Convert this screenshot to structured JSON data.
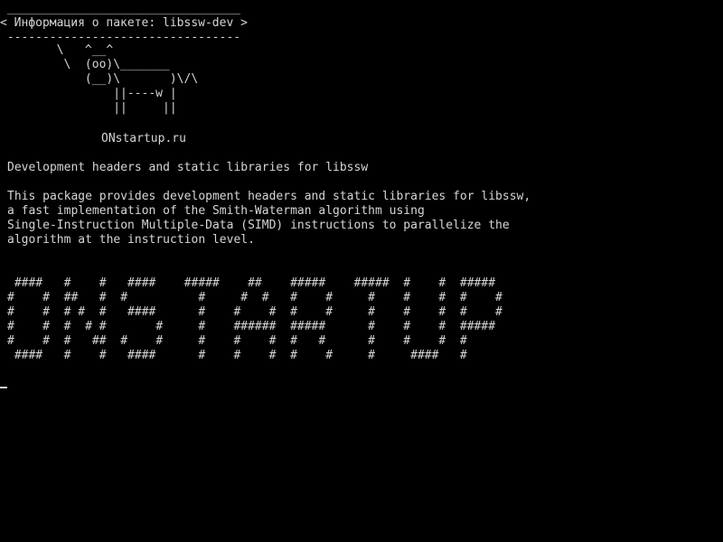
{
  "colors": {
    "background": "#000000",
    "foreground": "#d6d6d6"
  },
  "bubble": {
    "top_border": " _________________________________",
    "text": "< Информация о пакете: libssw-dev >",
    "bottom_border": " ---------------------------------"
  },
  "cow_art": "        \\   ^__^\n         \\  (oo)\\_______\n            (__)\\       )\\/\\\n                ||----w |\n                ||     ||",
  "site_label": "ONstartup.ru",
  "package": {
    "summary": "Development headers and static libraries for libssw",
    "description": "This package provides development headers and static libraries for libssw,\na fast implementation of the Smith-Waterman algorithm using\nSingle-Instruction Multiple-Data (SIMD) instructions to parallelize the\nalgorithm at the instruction level."
  },
  "banner_art": " ####   #    #   ####    #####    ##    #####    #####  #    #  #####\n#    #  ##   #  #          #     #  #   #    #     #    #    #  #    #\n#    #  # #  #   ####      #    #    #  #    #     #    #    #  #    #\n#    #  #  # #       #     #    ######  #####      #    #    #  #####\n#    #  #   ##  #    #     #    #    #  #   #      #    #    #  #\n ####   #    #   ####      #    #    #  #    #     #     ####   #"
}
